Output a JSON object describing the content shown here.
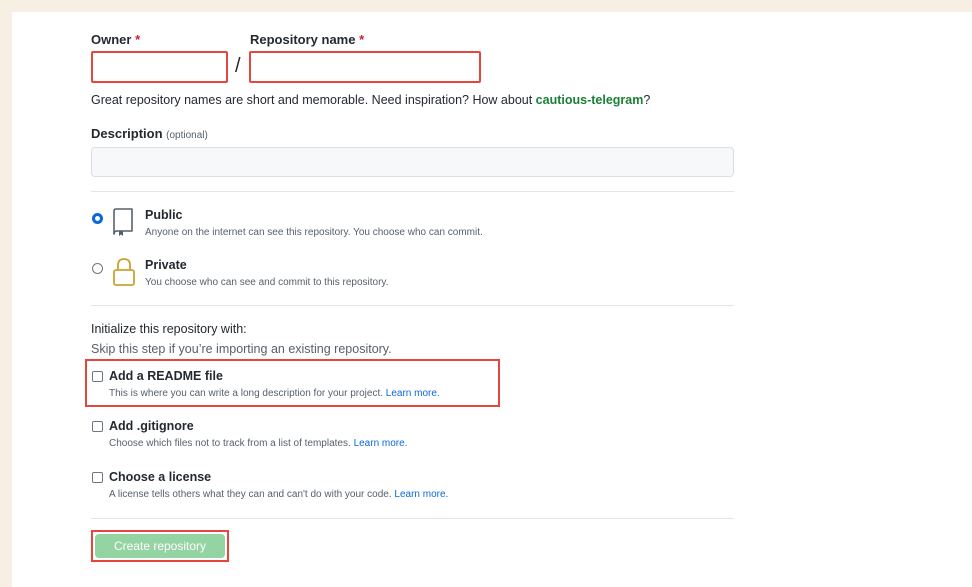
{
  "form": {
    "owner_label": "Owner",
    "required_mark": "*",
    "repo_name_label": "Repository name",
    "slash": "/",
    "name_hint_prefix": "Great repository names are short and memorable. Need inspiration? How about ",
    "name_suggestion": "cautious-telegram",
    "name_hint_suffix": "?",
    "description_label": "Description",
    "description_optional": "(optional)"
  },
  "visibility": {
    "selected": "public",
    "public": {
      "title": "Public",
      "desc": "Anyone on the internet can see this repository. You choose who can commit."
    },
    "private": {
      "title": "Private",
      "desc": "You choose who can see and commit to this repository."
    }
  },
  "init": {
    "heading": "Initialize this repository with:",
    "subheading": "Skip this step if you’re importing an existing repository.",
    "readme": {
      "title": "Add a README file",
      "desc": "This is where you can write a long description for your project.",
      "link": "Learn more."
    },
    "gitignore": {
      "title": "Add .gitignore",
      "desc": "Choose which files not to track from a list of templates.",
      "link": "Learn more."
    },
    "license": {
      "title": "Choose a license",
      "desc": "A license tells others what they can and can't do with your code.",
      "link": "Learn more."
    }
  },
  "submit_label": "Create repository",
  "colors": {
    "background": "#f7efe3",
    "highlight": "#e5473f",
    "suggestion": "#1a7f37",
    "link": "#0969da",
    "button": "#94d3a2",
    "radio_selected": "#0969da"
  }
}
